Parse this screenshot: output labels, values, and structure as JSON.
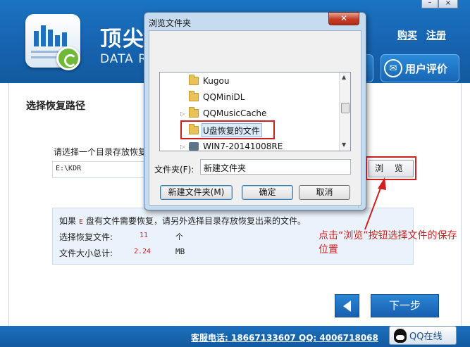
{
  "app": {
    "brand_title": "顶尖",
    "brand_subtitle": "DATA R",
    "links": {
      "buy": "购买",
      "register": "注册"
    },
    "review_button": "用户评价",
    "window_controls": {
      "minimize": "–",
      "close": "×"
    }
  },
  "main": {
    "section_title": "选择恢复路径",
    "path_prompt": "请选择一个目录存放恢复",
    "path_value": "E:\\KDR",
    "browse_button": "浏 览",
    "info": {
      "line_prefix": "如果",
      "drive": "E",
      "line_suffix": "盘有文件需要恢复，请另外选择目录存放恢复出来的文件。",
      "files_label": "选择恢复文件:",
      "files_value": "11",
      "files_unit": "个",
      "size_label": "文件大小总计:",
      "size_value": "2.24",
      "size_unit": "MB"
    },
    "annotation": "点击“浏览”按钮选择文件的保存位置",
    "next_button": "下一步"
  },
  "footer": {
    "contact": "客服电话: 18667133607 QQ: 4006718068",
    "qq_button": "QQ在线"
  },
  "dialog": {
    "title": "浏览文件夹",
    "close": "✕",
    "tree": [
      {
        "label": "Kugou",
        "icon": "folder-icon",
        "expander": ""
      },
      {
        "label": "QQMiniDL",
        "icon": "folder-icon",
        "expander": ""
      },
      {
        "label": "QQMusicCache",
        "icon": "folder-icon",
        "expander": "▷"
      },
      {
        "label": "U盘恢复的文件",
        "icon": "folder-icon",
        "expander": "",
        "selected": true
      },
      {
        "label": "WIN7-20141008RE",
        "icon": "computer-icon",
        "expander": "▷"
      }
    ],
    "folder_label": "文件夹(F):",
    "folder_value": "新建文件夹",
    "buttons": {
      "new_folder": "新建文件夹(M)",
      "ok": "确定",
      "cancel": "取消"
    }
  },
  "colors": {
    "header_blue": "#1662ae",
    "annotation_red": "#d01f1f",
    "dialog_frame": "#c7dbef"
  }
}
